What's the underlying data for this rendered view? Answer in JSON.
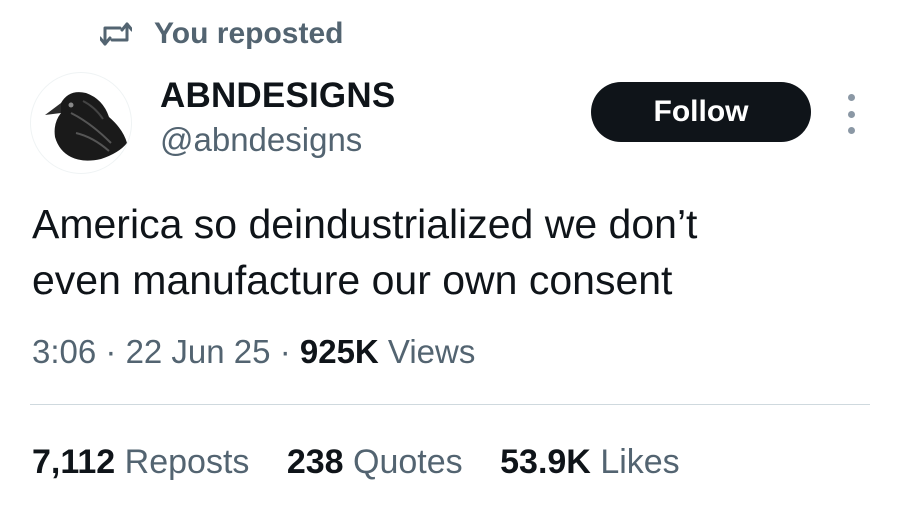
{
  "repost": {
    "icon": "repost-icon",
    "text": "You reposted"
  },
  "author": {
    "avatar_icon": "raven-avatar",
    "display_name": "ABNDESIGNS",
    "handle": "@abndesigns"
  },
  "follow_label": "Follow",
  "more_icon": "more-vertical-icon",
  "tweet": {
    "line1": "America so deindustrialized we don’t",
    "line2": "even manufacture our own consent"
  },
  "meta": {
    "time": "3:06",
    "sep1": " · ",
    "date": "22 Jun 25",
    "sep2": " · ",
    "views_count": "925K",
    "views_label": "Views"
  },
  "stats": {
    "reposts_count": "7,112",
    "reposts_label": "Reposts",
    "quotes_count": "238",
    "quotes_label": "Quotes",
    "likes_count": "53.9K",
    "likes_label": "Likes"
  },
  "colors": {
    "text_primary": "#0f1419",
    "text_secondary": "#536471",
    "button_bg": "#0f1419",
    "divider": "#cfd9de"
  }
}
